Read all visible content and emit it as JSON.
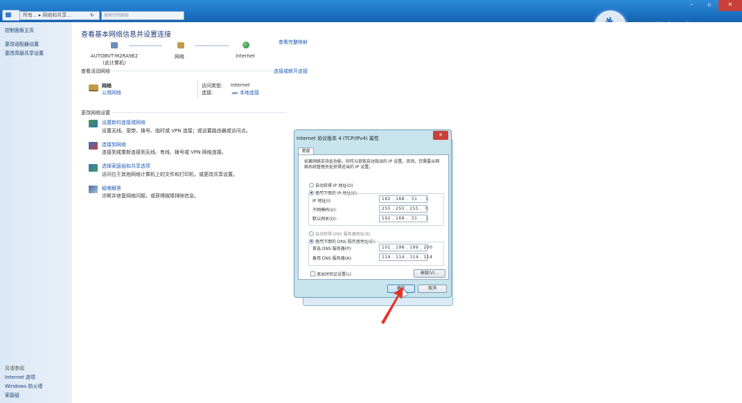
{
  "topbar": {
    "address_part1": "所有...",
    "address_sep": "▸",
    "address_part2": "网络和共享...",
    "search_placeholder": "搜索控制面板",
    "minimize": "–",
    "maximize": "▫",
    "close": "✕"
  },
  "watermark": {
    "text": "云骑士"
  },
  "sidebar": {
    "home": "控制面板主页",
    "adapter": "更改适配器设置",
    "advanced": "更改高级共享设置",
    "see_also": "另请参阅",
    "internet_options": "Internet 选项",
    "firewall": "Windows 防火墙",
    "homegroup": "家庭组"
  },
  "main": {
    "title": "查看基本网络信息并设置连接",
    "full_map": "查看完整映射",
    "map": {
      "computer_name": "AUTOBVT-M2RA9E2",
      "computer_sub": "(此计算机)",
      "network": "网络",
      "internet": "Internet"
    },
    "active_heading": "查看活动网络",
    "connect_disconnect": "连接或断开连接",
    "active": {
      "name": "网络",
      "type": "公用网络",
      "access_key": "访问类型:",
      "access_value": "Internet",
      "conn_key": "连接:",
      "conn_value": "本地连接"
    },
    "change_heading": "更改网络设置",
    "tasks": [
      {
        "link": "设置新的连接或网络",
        "desc": "设置无线、宽带、拨号、临时或 VPN 连接；或设置路由器或访问点。"
      },
      {
        "link": "连接到网络",
        "desc": "连接到或重新连接到无线、有线、拨号或 VPN 网络连接。"
      },
      {
        "link": "选择家庭组和共享选项",
        "desc": "访问位于其他网络计算机上的文件和打印机，或更改共享设置。"
      },
      {
        "link": "疑难解答",
        "desc": "诊断并修复网络问题，或获得故障排除信息。"
      }
    ]
  },
  "dialog": {
    "title": "Internet 协议版本 4 (TCP/IPv4) 属性",
    "close": "✕",
    "tab": "常规",
    "description": "如果网络支持此功能，则可以获取自动指派的 IP 设置。否则，您需要从网络系统管理员处获得适当的 IP 设置。",
    "auto_ip": "自动获得 IP 地址(O)",
    "manual_ip": "使用下面的 IP 地址(S):",
    "ip_label": "IP 地址(I):",
    "ip_value": "192 . 168 .  31  .  1",
    "mask_label": "子网掩码(U):",
    "mask_value": "255 . 255 . 255 .  0",
    "gateway_label": "默认网关(D):",
    "gateway_value": "192 . 168 .  31  .  1",
    "auto_dns": "自动获得 DNS 服务器地址(B)",
    "manual_dns": "使用下面的 DNS 服务器地址(E):",
    "dns1_label": "首选 DNS 服务器(P):",
    "dns1_value": "101 . 198 . 199 . 200",
    "dns2_label": "备用 DNS 服务器(A):",
    "dns2_value": "114 . 114 . 114 . 114",
    "validate": "退出时验证设置(L)",
    "advanced": "高级(V)...",
    "ok": "确定",
    "cancel": "取消"
  },
  "colors": {
    "accent": "#1f58b6",
    "titlebar": "#1a73c4",
    "dialog_frame": "#c7e3ec",
    "arrow": "#e8302a"
  }
}
